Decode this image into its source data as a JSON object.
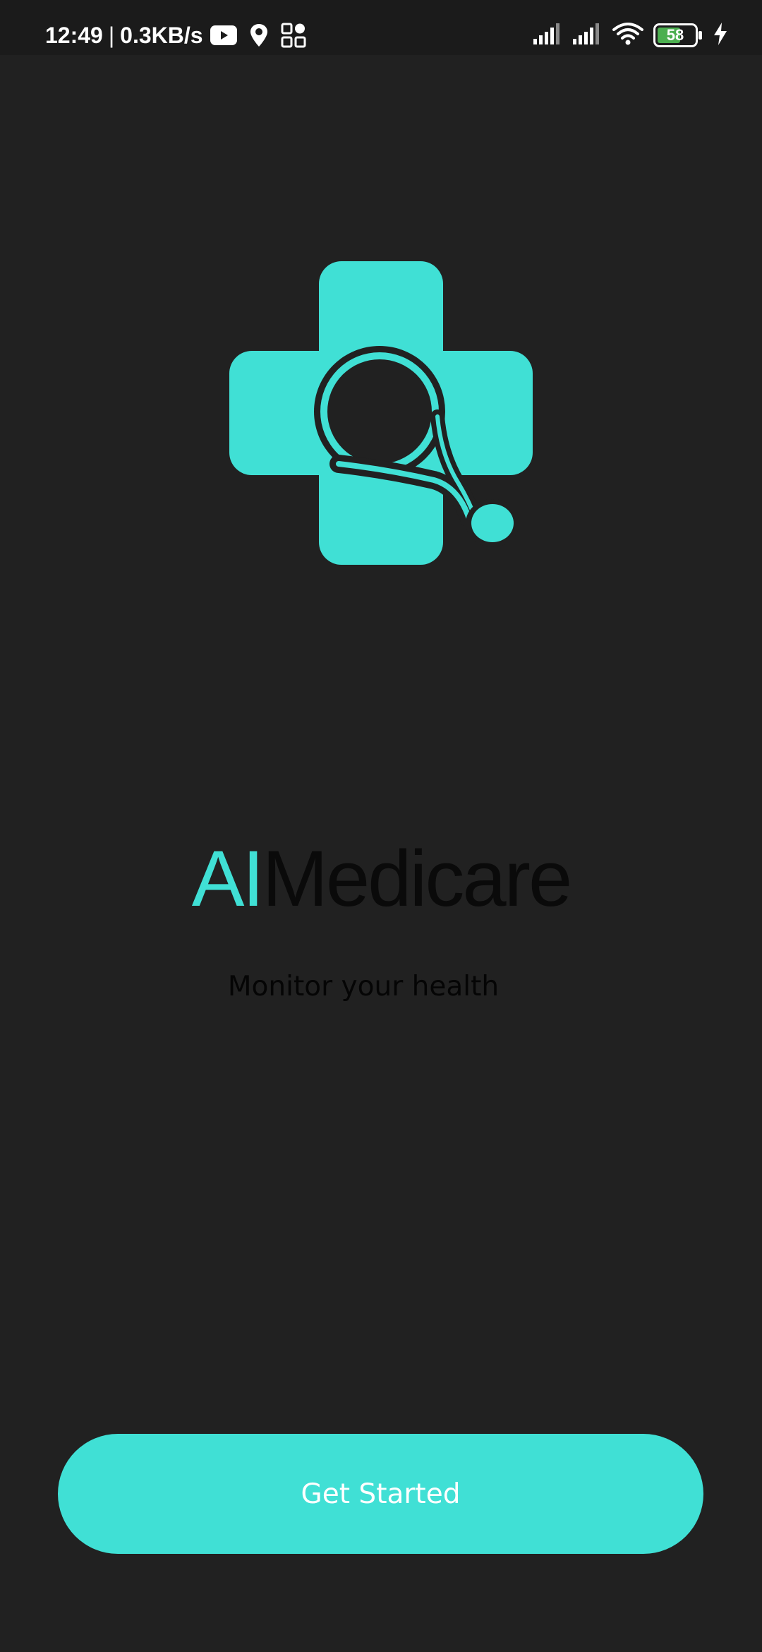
{
  "status_bar": {
    "time": "12:49",
    "separator": "|",
    "network_speed": "0.3KB/s",
    "battery_level": "58",
    "icons": [
      "youtube-icon",
      "location-pin-icon",
      "app-grid-icon",
      "signal-icon",
      "signal-icon",
      "wifi-icon",
      "battery-icon",
      "charging-bolt-icon"
    ]
  },
  "brand": {
    "highlight": "AI",
    "rest": "Medicare",
    "tagline": "Monitor your health"
  },
  "actions": {
    "get_started_label": "Get Started"
  },
  "colors": {
    "background": "#212121",
    "accent": "#40E0D5",
    "title_dark": "#0a0a0a",
    "status_bar": "#1b1b1b"
  }
}
